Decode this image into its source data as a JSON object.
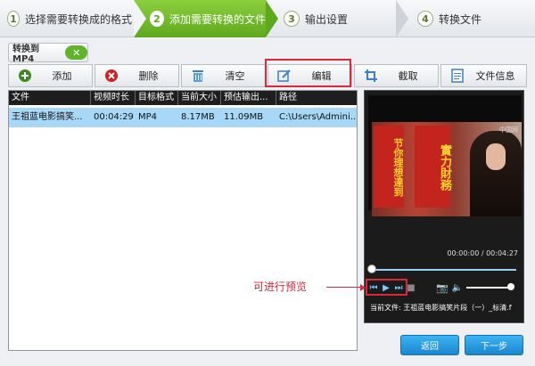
{
  "steps": [
    {
      "num": "1",
      "label": "选择需要转换成的格式"
    },
    {
      "num": "2",
      "label": "添加需要转换的文件"
    },
    {
      "num": "3",
      "label": "输出设置"
    },
    {
      "num": "4",
      "label": "转换文件"
    }
  ],
  "convert_to": {
    "label": "转换到 MP4"
  },
  "toolbar": {
    "add": "添加",
    "delete": "删除",
    "clear": "清空",
    "edit": "编辑",
    "crop": "截取",
    "file_info": "文件信息"
  },
  "table": {
    "headers": [
      "文件",
      "视频时长",
      "目标格式",
      "当前大小",
      "预估输出...",
      "路径"
    ],
    "rows": [
      [
        "王祖蓝电影搞笑...",
        "00:04:29",
        "MP4",
        "8.17MB",
        "11.09MB",
        "C:\\Users\\Admini..."
      ]
    ]
  },
  "preview": {
    "banner_left": "节你理想達到",
    "banner_right": "實力財務",
    "watermark": "中国网",
    "time": "00:00:00 / 00:04:27",
    "current_file": "当前文件: 王祖蓝电影搞笑片段（一）_标清.f"
  },
  "annotation": "可进行预览",
  "buttons": {
    "back": "返回",
    "next": "下一步"
  },
  "colors": {
    "accent_green": "#5ea81c",
    "highlight_red": "#d8283b",
    "button_blue": "#1b86cf",
    "row_select": "#a7d8f7"
  }
}
